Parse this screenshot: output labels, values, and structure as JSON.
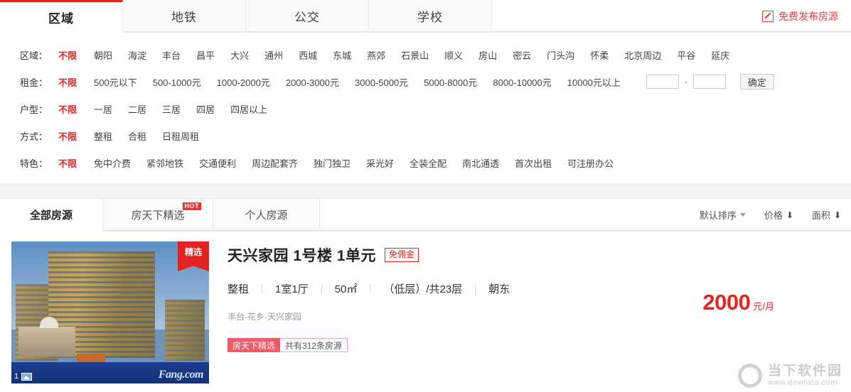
{
  "header": {
    "tabs": [
      {
        "label": "区域",
        "active": true
      },
      {
        "label": "地铁",
        "active": false
      },
      {
        "label": "公交",
        "active": false
      },
      {
        "label": "学校",
        "active": false
      }
    ],
    "publish_label": "免费发布房源"
  },
  "filters": {
    "rows": [
      {
        "label": "区域：",
        "options": [
          "不限",
          "朝阳",
          "海淀",
          "丰台",
          "昌平",
          "大兴",
          "通州",
          "西城",
          "东城",
          "燕郊",
          "石景山",
          "顺义",
          "房山",
          "密云",
          "门头沟",
          "怀柔",
          "北京周边",
          "平谷",
          "延庆"
        ],
        "selected": "不限"
      },
      {
        "label": "租金：",
        "options": [
          "不限",
          "500元以下",
          "500-1000元",
          "1000-2000元",
          "2000-3000元",
          "3000-5000元",
          "5000-8000元",
          "8000-10000元",
          "10000元以上"
        ],
        "selected": "不限",
        "price_min_value": "",
        "price_max_value": "",
        "separator": "-",
        "confirm_label": "确定"
      },
      {
        "label": "户型：",
        "options": [
          "不限",
          "一居",
          "二居",
          "三居",
          "四居",
          "四居以上"
        ],
        "selected": "不限"
      },
      {
        "label": "方式：",
        "options": [
          "不限",
          "整租",
          "合租",
          "日租周租"
        ],
        "selected": "不限"
      },
      {
        "label": "特色：",
        "options": [
          "不限",
          "免中介费",
          "紧邻地铁",
          "交通便利",
          "周边配套齐",
          "独门独卫",
          "采光好",
          "全装全配",
          "南北通透",
          "首次出租",
          "可注册办公"
        ],
        "selected": "不限"
      }
    ]
  },
  "list_tabs": {
    "tabs": [
      {
        "label": "全部房源",
        "active": true,
        "badge": ""
      },
      {
        "label": "房天下精选",
        "active": false,
        "badge": "HOT"
      },
      {
        "label": "个人房源",
        "active": false,
        "badge": ""
      }
    ],
    "sort": [
      {
        "label": "默认排序",
        "icon": "chevron-down"
      },
      {
        "label": "价格",
        "icon": "arrow-down"
      },
      {
        "label": "面积",
        "icon": "arrow-down"
      }
    ]
  },
  "listing": {
    "ribbon": "精选",
    "photo_count": "1",
    "photo_watermark": "Fang.com",
    "title": "天兴家园 1号楼 1单元",
    "no_fee_badge": "免佣金",
    "meta": [
      "整租",
      "1室1厅",
      "50㎡",
      "（低层）/共23层",
      "朝东"
    ],
    "address": "丰台-花乡-天兴家园",
    "tag_red": "房天下精选",
    "tag_white": "共有312条房源",
    "price": "2000",
    "price_unit": "元/月"
  },
  "watermark": {
    "name": "当下软件园",
    "url": "www.downxia.com"
  },
  "colors": {
    "accent_red": "#e32322",
    "price_red": "#ee2222",
    "tag_pink": "#ee5a6a",
    "hot_red": "#f03030"
  }
}
